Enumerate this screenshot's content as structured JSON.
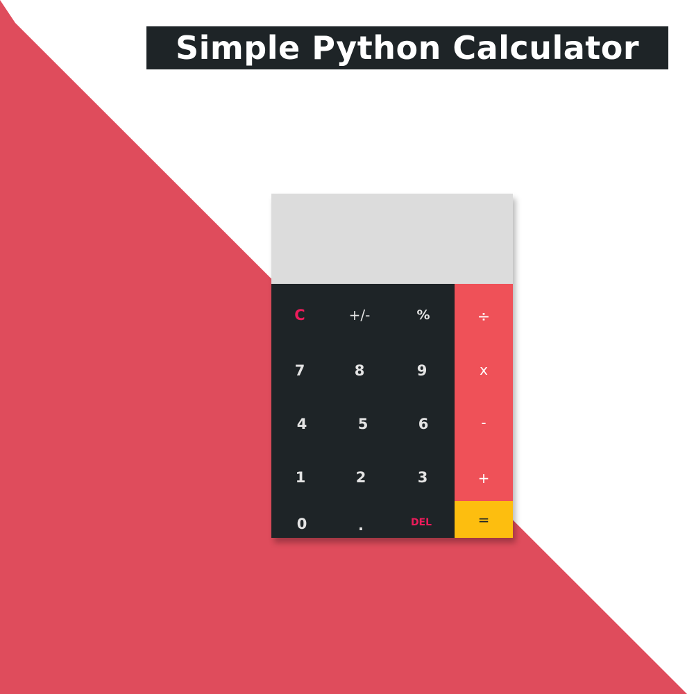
{
  "title": "Simple Python Calculator",
  "colors": {
    "background_red": "#df4c5c",
    "background_white": "#ffffff",
    "title_bar": "#1e2427",
    "display": "#dcdcdc",
    "keypad": "#1e2427",
    "operators": "#ef5158",
    "equals": "#fdbe0f",
    "accent_text": "#ec1c5b"
  },
  "calculator": {
    "display_value": "",
    "keys": {
      "clear": "C",
      "sign": "+/-",
      "percent": "%",
      "seven": "7",
      "eight": "8",
      "nine": "9",
      "four": "4",
      "five": "5",
      "six": "6",
      "one": "1",
      "two": "2",
      "three": "3",
      "zero": "0",
      "dot": ".",
      "delete": "DEL"
    },
    "operators": {
      "divide": "÷",
      "multiply": "x",
      "subtract": "-",
      "add": "+",
      "equals": "="
    }
  }
}
